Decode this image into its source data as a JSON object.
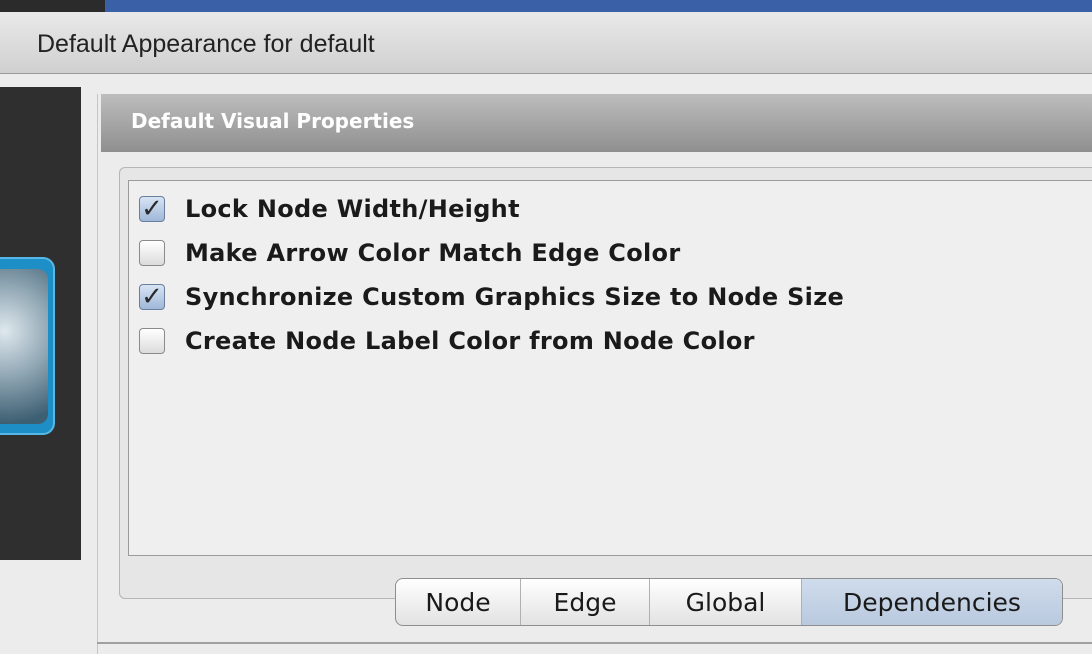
{
  "window": {
    "title": "Default Appearance for default"
  },
  "panel": {
    "header": "Default Visual Properties"
  },
  "options": [
    {
      "label": "Lock Node Width/Height",
      "checked": true
    },
    {
      "label": "Make Arrow Color Match Edge Color",
      "checked": false
    },
    {
      "label": "Synchronize Custom Graphics Size to Node Size",
      "checked": true
    },
    {
      "label": "Create Node Label Color from Node Color",
      "checked": false
    }
  ],
  "tabs": [
    {
      "label": "Node",
      "selected": false
    },
    {
      "label": "Edge",
      "selected": false
    },
    {
      "label": "Global",
      "selected": false
    },
    {
      "label": "Dependencies",
      "selected": true
    }
  ],
  "check_glyph": "✓",
  "colors": {
    "accent": "#3a60a8",
    "selected_tab": "#c4d3e6",
    "logo": "#1e8fc6"
  }
}
